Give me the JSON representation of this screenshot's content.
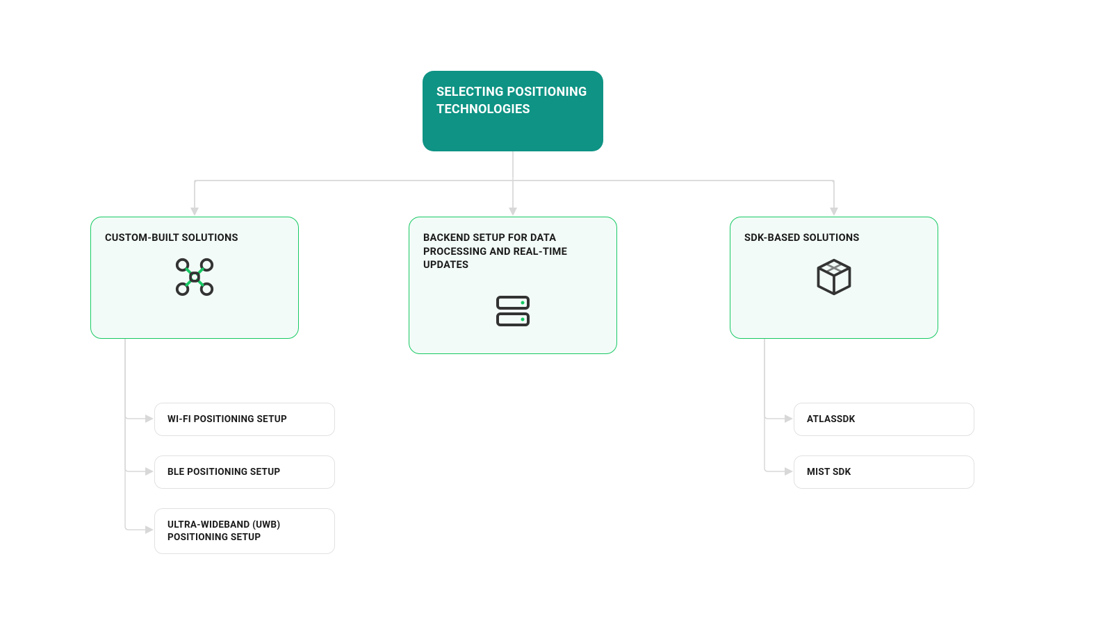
{
  "root": {
    "title": "Selecting Positioning Technologies"
  },
  "branches": {
    "custom": {
      "title": "Custom-Built Solutions",
      "children": [
        "Wi-Fi Positioning Setup",
        "BLE Positioning Setup",
        "Ultra-Wideband (UWB) Positioning Setup"
      ]
    },
    "backend": {
      "title": "Backend Setup for Data Processing and Real-Time Updates"
    },
    "sdk": {
      "title": "SDK-Based Solutions",
      "children": [
        "AtlasSDK",
        "Mist SDK"
      ]
    }
  },
  "colors": {
    "rootBg": "#0E9384",
    "branchBorder": "#17C964",
    "branchBg": "#F2FBF7",
    "childBorder": "#e1e1e1",
    "connector": "#d8d8d8"
  }
}
